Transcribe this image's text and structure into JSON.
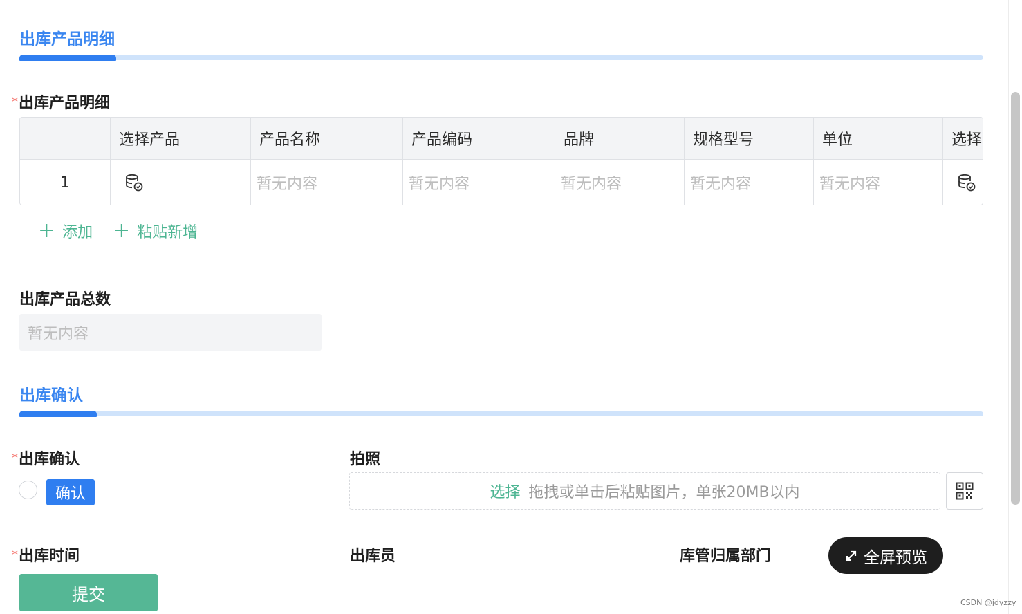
{
  "section_product": {
    "title": "出库产品明细"
  },
  "product_field": {
    "label": "出库产品明细",
    "required": "*"
  },
  "table": {
    "headers": [
      "",
      "选择产品",
      "产品名称",
      "产品编码",
      "品牌",
      "规格型号",
      "单位",
      "选择"
    ],
    "rows": [
      {
        "index": "1",
        "name": "暂无内容",
        "code": "暂无内容",
        "brand": "暂无内容",
        "spec": "暂无内容",
        "unit": "暂无内容"
      }
    ]
  },
  "actions": {
    "add": "添加",
    "paste_add": "粘贴新增"
  },
  "total_field": {
    "label": "出库产品总数",
    "value": "暂无内容"
  },
  "section_confirm": {
    "title": "出库确认"
  },
  "confirm_field": {
    "label": "出库确认",
    "required": "*",
    "option": "确认"
  },
  "photo_field": {
    "label": "拍照",
    "select": "选择",
    "hint": "拖拽或单击后粘贴图片，单张20MB以内"
  },
  "time_field": {
    "label": "出库时间",
    "required": "*"
  },
  "operator_field": {
    "label": "出库员"
  },
  "dept_field": {
    "label": "库管归属部门"
  },
  "buttons": {
    "submit": "提交",
    "fullscreen": "全屏预览"
  },
  "watermark": "CSDN @jdyzzy",
  "colors": {
    "accent_blue": "#2f7ef0",
    "accent_green": "#55b795",
    "link_green": "#4db592",
    "required_red": "#f5736c"
  }
}
